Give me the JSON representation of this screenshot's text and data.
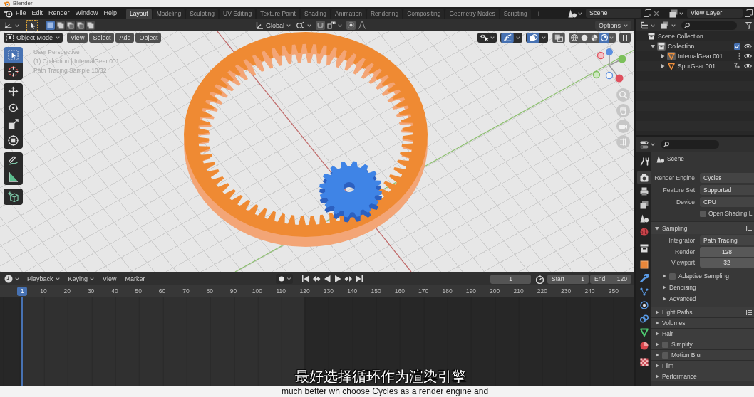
{
  "title_bar": {
    "title": "Blender"
  },
  "menu_bar": {
    "menus": [
      "File",
      "Edit",
      "Render",
      "Window",
      "Help"
    ],
    "workspaces": [
      {
        "label": "Layout",
        "selected": true
      },
      {
        "label": "Modeling",
        "selected": false
      },
      {
        "label": "Sculpting",
        "selected": false
      },
      {
        "label": "UV Editing",
        "selected": false
      },
      {
        "label": "Texture Paint",
        "selected": false
      },
      {
        "label": "Shading",
        "selected": false
      },
      {
        "label": "Animation",
        "selected": false
      },
      {
        "label": "Rendering",
        "selected": false
      },
      {
        "label": "Compositing",
        "selected": false
      },
      {
        "label": "Geometry Nodes",
        "selected": false
      },
      {
        "label": "Scripting",
        "selected": false
      }
    ],
    "add_workspace": "+",
    "scene": "Scene",
    "view_layer": "View Layer"
  },
  "tool_header": {
    "select_modes": [
      {
        "selected": true
      },
      {
        "selected": false
      },
      {
        "selected": false
      },
      {
        "selected": false
      },
      {
        "selected": false
      }
    ],
    "orientation": "Global",
    "options": "Options"
  },
  "viewport": {
    "mode": "Object Mode",
    "menus": [
      "View",
      "Select",
      "Add",
      "Object"
    ],
    "overlay_toggles": [
      {
        "kind": "gizmo",
        "on": true
      },
      {
        "kind": "overlays",
        "on": true
      },
      {
        "kind": "xray",
        "on": false
      }
    ],
    "shading_modes": [
      {
        "kind": "wireframe",
        "selected": false
      },
      {
        "kind": "solid",
        "selected": false
      },
      {
        "kind": "material",
        "selected": false
      },
      {
        "kind": "rendered",
        "selected": true
      }
    ],
    "info": [
      "User Perspective",
      "(1) Collection | InternalGear.001",
      "Path Tracing Sample 10/32"
    ],
    "tool_groups": [
      {
        "tools": [
          {
            "kind": "select_box",
            "selected": true
          },
          {
            "kind": "cursor",
            "selected": false
          }
        ]
      },
      {
        "tools": [
          {
            "kind": "move",
            "selected": false
          },
          {
            "kind": "rotate",
            "selected": false
          },
          {
            "kind": "scale",
            "selected": false
          },
          {
            "kind": "transform",
            "selected": false
          }
        ]
      },
      {
        "tools": [
          {
            "kind": "annotate",
            "selected": false
          },
          {
            "kind": "measure",
            "selected": false
          }
        ]
      },
      {
        "tools": [
          {
            "kind": "add_cube",
            "selected": false
          }
        ]
      }
    ]
  },
  "timeline": {
    "menus": [
      {
        "label": "Playback",
        "kind": "dropdown"
      },
      {
        "label": "Keying",
        "kind": "dropdown"
      },
      {
        "label": "View",
        "kind": "menu"
      },
      {
        "label": "Marker",
        "kind": "menu"
      }
    ],
    "current_frame": "1",
    "start": {
      "label": "Start",
      "value": "1"
    },
    "end": {
      "label": "End",
      "value": "120"
    },
    "playhead": "1",
    "ticks": [
      "10",
      "20",
      "30",
      "40",
      "50",
      "60",
      "70",
      "80",
      "90",
      "100",
      "110",
      "120",
      "130",
      "140",
      "150",
      "160",
      "170",
      "180",
      "190",
      "200",
      "210",
      "220",
      "230",
      "240",
      "250"
    ]
  },
  "outliner": {
    "tree": [
      {
        "label": "Scene Collection",
        "kind": "scene_collection",
        "children": [
          {
            "label": "Collection",
            "kind": "collection",
            "expanded": true,
            "checked": true,
            "visible": true,
            "children": [
              {
                "label": "InternalGear.001",
                "kind": "mesh",
                "expanded": false,
                "selected": true,
                "visible": true,
                "extras": [
                  {
                    "kind": "dots"
                  }
                ]
              },
              {
                "label": "SpurGear.001",
                "kind": "mesh",
                "expanded": false,
                "selected": false,
                "visible": true,
                "extras": [
                  {
                    "kind": "modifier"
                  }
                ]
              }
            ]
          }
        ]
      }
    ]
  },
  "properties": {
    "tabs": [
      {
        "kind": "tool",
        "selected": false
      },
      {
        "kind": "render",
        "selected": true
      },
      {
        "kind": "output",
        "selected": false
      },
      {
        "kind": "view_layer",
        "selected": false
      },
      {
        "kind": "scene",
        "selected": false
      },
      {
        "kind": "world",
        "selected": false
      },
      {
        "kind": "collection",
        "selected": false
      },
      {
        "kind": "object",
        "selected": false
      },
      {
        "kind": "modifiers",
        "selected": false
      },
      {
        "kind": "particles",
        "selected": false
      },
      {
        "kind": "physics",
        "selected": false
      },
      {
        "kind": "constraints",
        "selected": false
      },
      {
        "kind": "data",
        "selected": false
      },
      {
        "kind": "material",
        "selected": false
      },
      {
        "kind": "texture",
        "selected": false
      }
    ],
    "context": "Scene",
    "fields": [
      {
        "label": "Render Engine",
        "value": "Cycles"
      },
      {
        "label": "Feature Set",
        "value": "Supported"
      },
      {
        "label": "Device",
        "value": "CPU"
      }
    ],
    "open_shading_language": {
      "label": "Open Shading L",
      "checked": false
    },
    "panels": [
      {
        "title": "Sampling",
        "kind": "plain",
        "expanded": true,
        "presets": true,
        "integrator": {
          "label": "Integrator",
          "value": "Path Tracing"
        },
        "samples": [
          {
            "label": "Render",
            "value": "128"
          },
          {
            "label": "Viewport",
            "value": "32"
          }
        ],
        "subpanels": [
          {
            "title": "Adaptive Sampling",
            "kind": "checkbox",
            "checked": false,
            "expanded": false
          },
          {
            "title": "Denoising",
            "kind": "plain",
            "expanded": false
          },
          {
            "title": "Advanced",
            "kind": "plain",
            "expanded": false
          }
        ]
      },
      {
        "title": "Light Paths",
        "kind": "plain",
        "expanded": false,
        "presets": true
      },
      {
        "title": "Volumes",
        "kind": "plain",
        "expanded": false,
        "presets": false
      },
      {
        "title": "Hair",
        "kind": "plain",
        "expanded": false,
        "presets": false
      },
      {
        "title": "Simplify",
        "kind": "checkbox",
        "checked": false,
        "expanded": false,
        "presets": false
      },
      {
        "title": "Motion Blur",
        "kind": "checkbox",
        "checked": false,
        "expanded": false,
        "presets": false
      },
      {
        "title": "Film",
        "kind": "plain",
        "expanded": false,
        "presets": false
      },
      {
        "title": "Performance",
        "kind": "plain",
        "expanded": false,
        "presets": false
      }
    ]
  },
  "subtitles": {
    "line_1": "最好选择循环作为渲染引擎",
    "line_2": "much better wh choose Cycles as a render engine and"
  }
}
